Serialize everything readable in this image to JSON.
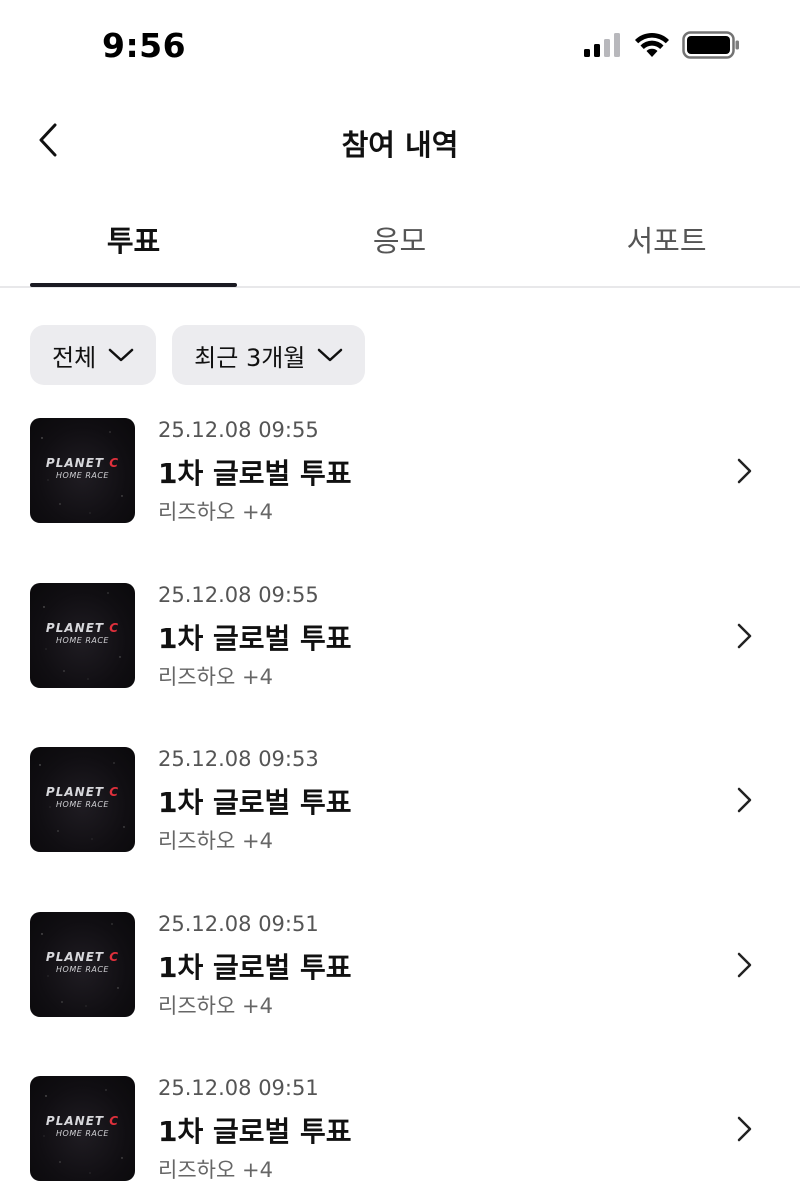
{
  "status_bar": {
    "time": "9:56",
    "icons": [
      "cellular-signal-icon",
      "wifi-icon",
      "battery-icon"
    ]
  },
  "header": {
    "title": "참여 내역",
    "back_icon": "chevron-left-icon"
  },
  "tabs": [
    {
      "label": "투표",
      "selected": true
    },
    {
      "label": "응모",
      "selected": false
    },
    {
      "label": "서포트",
      "selected": false
    }
  ],
  "filters": [
    {
      "label": "전체",
      "icon": "chevron-down-icon"
    },
    {
      "label": "최근 3개월",
      "icon": "chevron-down-icon"
    }
  ],
  "items": [
    {
      "thumb_line1": "PLANET",
      "thumb_c": "C",
      "thumb_line2": "HOME RACE",
      "date": "25.12.08 09:55",
      "title": "1차 글로벌 투표",
      "sub": "리즈하오",
      "sub_count": "+4"
    },
    {
      "thumb_line1": "PLANET",
      "thumb_c": "C",
      "thumb_line2": "HOME RACE",
      "date": "25.12.08 09:55",
      "title": "1차 글로벌 투표",
      "sub": "리즈하오",
      "sub_count": "+4"
    },
    {
      "thumb_line1": "PLANET",
      "thumb_c": "C",
      "thumb_line2": "HOME RACE",
      "date": "25.12.08 09:53",
      "title": "1차 글로벌 투표",
      "sub": "리즈하오",
      "sub_count": "+4"
    },
    {
      "thumb_line1": "PLANET",
      "thumb_c": "C",
      "thumb_line2": "HOME RACE",
      "date": "25.12.08 09:51",
      "title": "1차 글로벌 투표",
      "sub": "리즈하오",
      "sub_count": "+4"
    },
    {
      "thumb_line1": "PLANET",
      "thumb_c": "C",
      "thumb_line2": "HOME RACE",
      "date": "25.12.08 09:51",
      "title": "1차 글로벌 투표",
      "sub": "리즈하오",
      "sub_count": "+4"
    }
  ],
  "colors": {
    "tab_indicator": "#1a1a22",
    "chip_bg": "#ececef",
    "logo_accent": "#e0303c"
  }
}
